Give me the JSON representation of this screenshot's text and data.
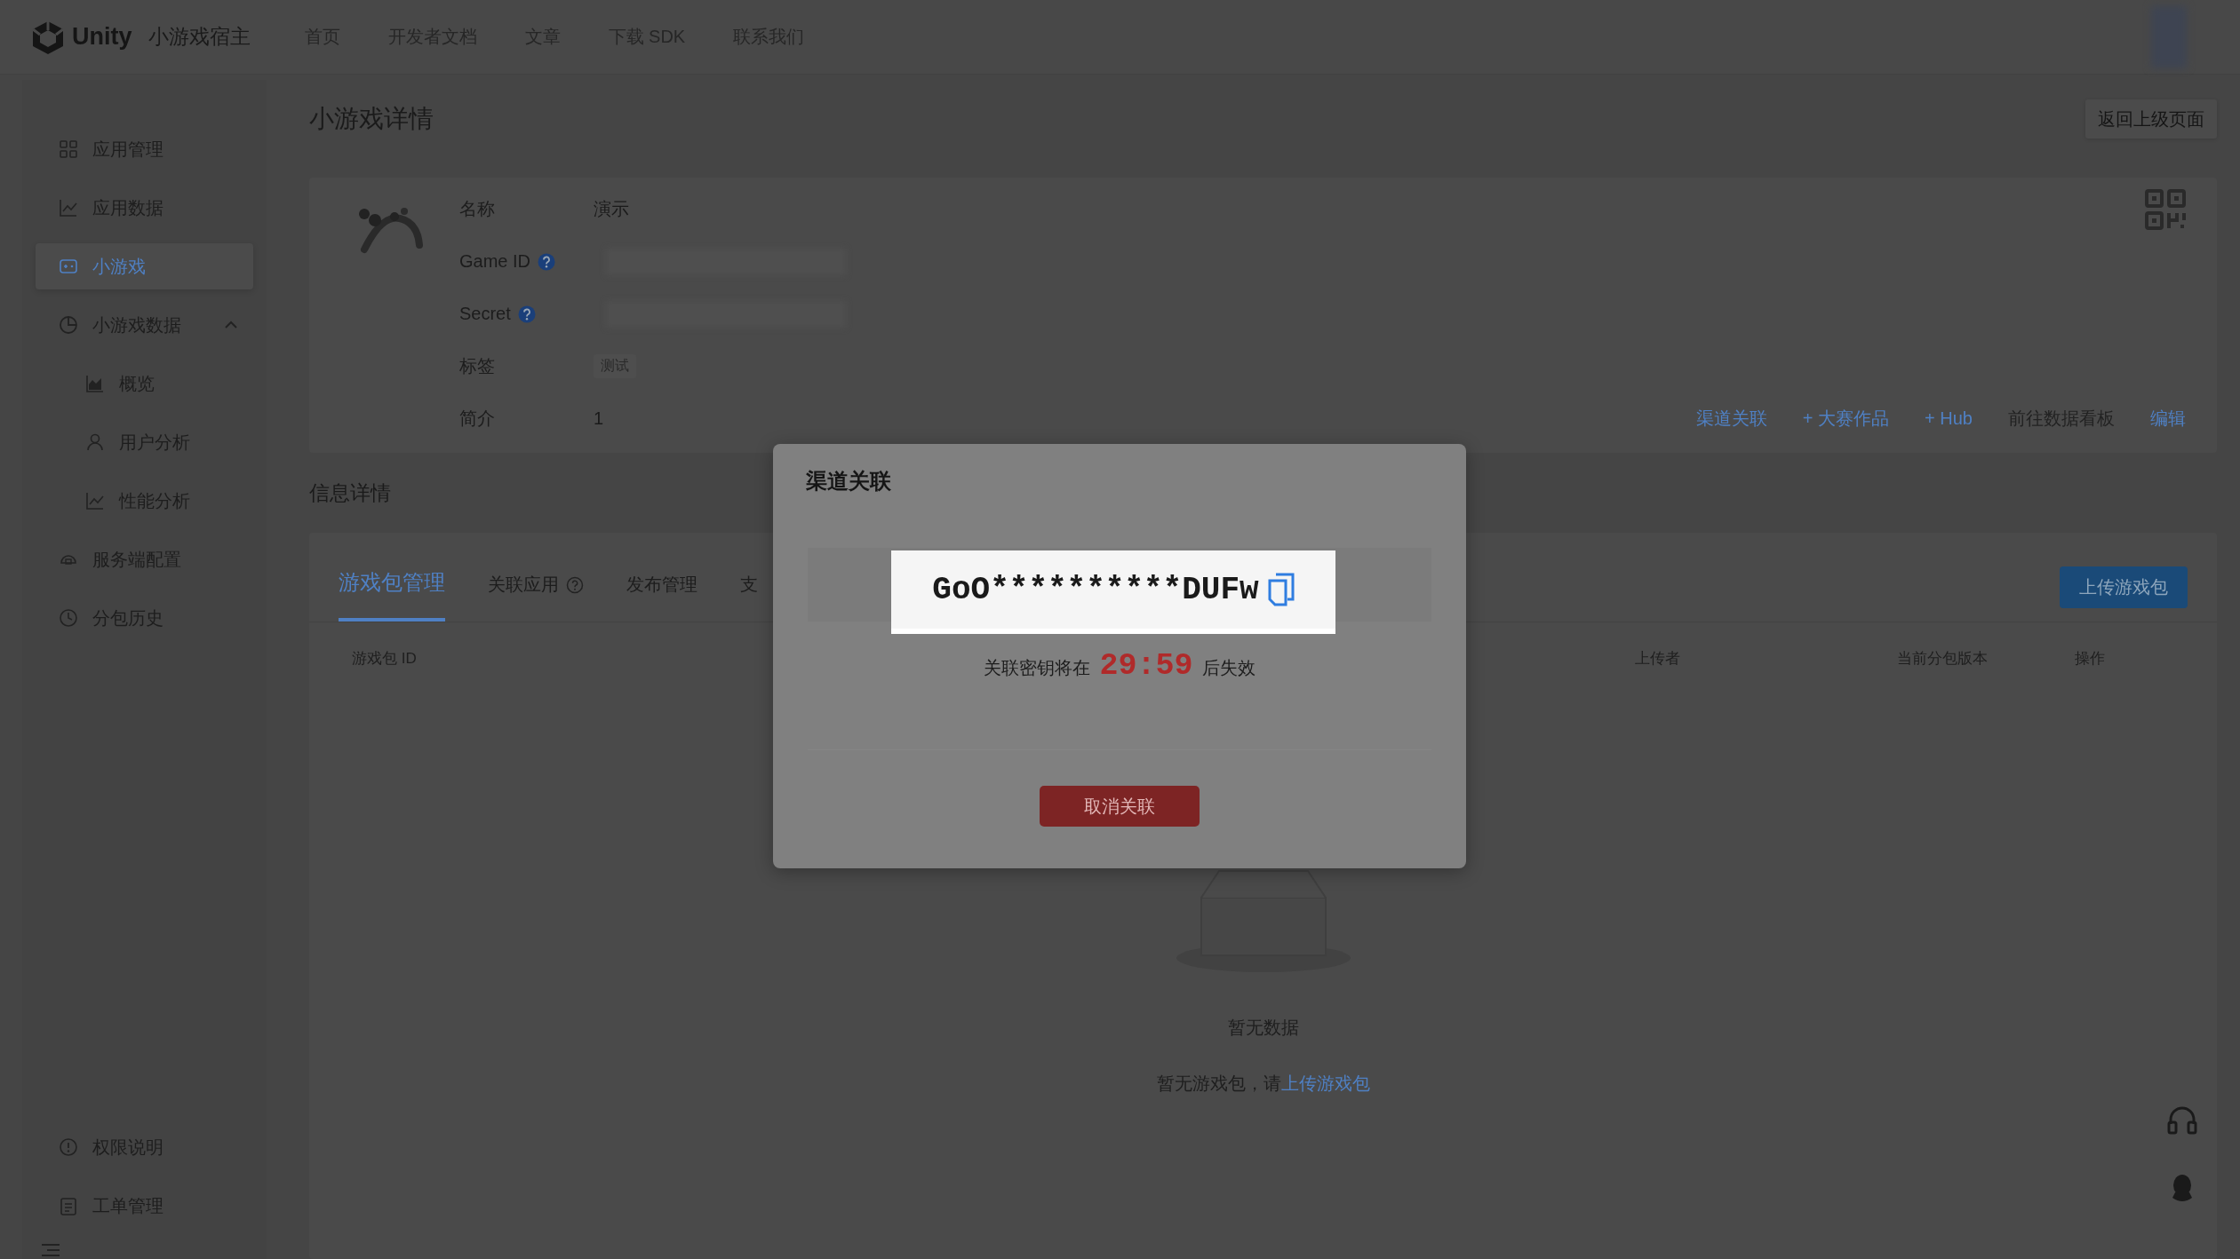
{
  "top_bar": {
    "brand": "Unity",
    "product": "小游戏宿主",
    "nav": [
      "首页",
      "开发者文档",
      "文章",
      "下载 SDK",
      "联系我们"
    ]
  },
  "sidebar": {
    "items": [
      {
        "label": "应用管理",
        "selected": false
      },
      {
        "label": "应用数据",
        "selected": false
      },
      {
        "label": "小游戏",
        "selected": true
      },
      {
        "label": "小游戏数据",
        "selected": false,
        "expanded": true,
        "children": [
          {
            "label": "概览",
            "selected": false
          },
          {
            "label": "用户分析",
            "selected": false
          },
          {
            "label": "性能分析",
            "selected": false
          }
        ]
      },
      {
        "label": "服务端配置",
        "selected": false
      },
      {
        "label": "分包历史",
        "selected": false
      }
    ],
    "bottom_items": [
      {
        "label": "权限说明"
      },
      {
        "label": "工单管理"
      }
    ]
  },
  "page": {
    "title": "小游戏详情",
    "back_button": "返回上级页面"
  },
  "game_card": {
    "fields": [
      {
        "label": "名称",
        "kind": "text",
        "value": "演示",
        "help": false
      },
      {
        "label": "Game ID",
        "kind": "blurred",
        "help": true
      },
      {
        "label": "Secret",
        "kind": "blurred",
        "help": true
      },
      {
        "label": "标签",
        "kind": "tag",
        "value": "测试",
        "help": false
      },
      {
        "label": "简介",
        "kind": "text",
        "value": "1",
        "help": false
      }
    ],
    "actions": [
      {
        "label": "渠道关联",
        "disabled": false
      },
      {
        "label": "+ 大赛作品",
        "disabled": false
      },
      {
        "label": "+ Hub",
        "disabled": false
      },
      {
        "label": "前往数据看板",
        "disabled": true
      },
      {
        "label": "编辑",
        "disabled": false
      }
    ]
  },
  "section_title": "信息详情",
  "packages": {
    "tabs": [
      {
        "label": "游戏包管理",
        "selected": true,
        "help": false
      },
      {
        "label": "关联应用",
        "selected": false,
        "help": true
      },
      {
        "label": "发布管理",
        "selected": false,
        "help": false
      },
      {
        "label": "支",
        "selected": false,
        "help": false
      }
    ],
    "upload_button": "上传游戏包",
    "columns": [
      "游戏包 ID",
      "上传者",
      "当前分包版本",
      "操作"
    ],
    "empty_title": "暂无数据",
    "empty_message": "暂无游戏包，请",
    "empty_link": "上传游戏包"
  },
  "dialog": {
    "title": "渠道关联",
    "key": "GoO**********DUFw",
    "expiry_prefix": "关联密钥将在",
    "countdown": "29:59",
    "expiry_suffix": "后失效",
    "cancel_button": "取消关联"
  }
}
